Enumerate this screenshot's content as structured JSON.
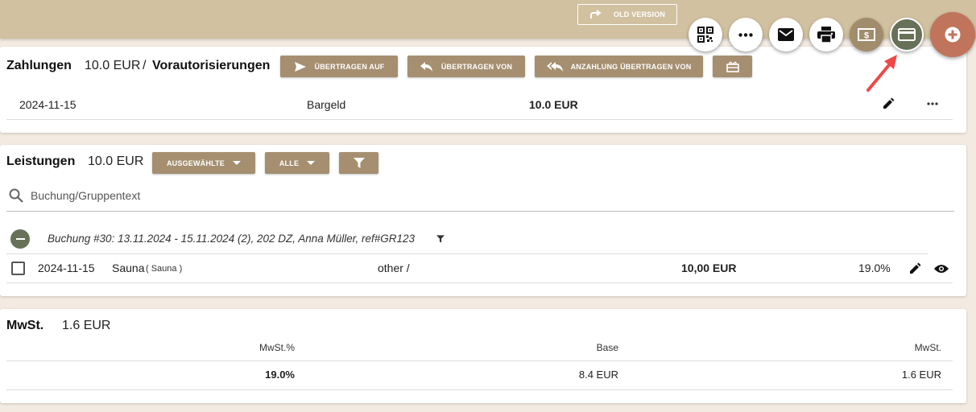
{
  "topbar": {
    "old_version_label": "OLD VERSION"
  },
  "fabs": [
    {
      "name": "qr-code",
      "icon": "qr-code-icon"
    },
    {
      "name": "more",
      "icon": "more-horiz-icon"
    },
    {
      "name": "mail",
      "icon": "mail-icon"
    },
    {
      "name": "print",
      "icon": "print-icon"
    },
    {
      "name": "money",
      "icon": "money-icon"
    },
    {
      "name": "credit-card",
      "icon": "credit-card-icon"
    },
    {
      "name": "add",
      "icon": "plus-icon"
    }
  ],
  "payments": {
    "title": "Zahlungen",
    "amount": "10.0 EUR",
    "separator": "/",
    "preauth_label": "Vorautorisierungen",
    "buttons": {
      "transfer_to": "ÜBERTRAGEN AUF",
      "transfer_from": "ÜBERTRAGEN VON",
      "deposit_transfer_from": "ANZAHLUNG ÜBERTRAGEN VON"
    },
    "rows": [
      {
        "date": "2024-11-15",
        "method": "Bargeld",
        "amount": "10.0 EUR"
      }
    ]
  },
  "services": {
    "title": "Leistungen",
    "amount": "10.0 EUR",
    "buttons": {
      "selected": "AUSGEWÄHLTE",
      "all": "ALLE"
    },
    "search_placeholder": "Buchung/Gruppentext",
    "booking_group": "Buchung #30: 13.11.2024 - 15.11.2024 (2), 202 DZ, Anna Müller, ref#GR123",
    "rows": [
      {
        "date": "2024-11-15",
        "name": "Sauna",
        "sub": "( Sauna )",
        "category": "other /",
        "amount": "10,00 EUR",
        "tax": "19.0%"
      }
    ]
  },
  "vat": {
    "title": "MwSt.",
    "amount": "1.6 EUR",
    "headers": {
      "pct": "MwSt.%",
      "base": "Base",
      "vat": "MwSt."
    },
    "rows": [
      {
        "pct": "19.0%",
        "base": "8.4 EUR",
        "vat": "1.6 EUR"
      }
    ]
  },
  "colors": {
    "topbar": "#d1c1a0",
    "button": "#a58f70",
    "accent_green": "#677158",
    "fab_add": "#c0745c",
    "arrow": "#f04848"
  }
}
